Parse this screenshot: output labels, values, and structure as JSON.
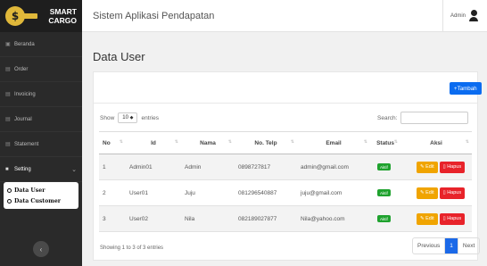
{
  "brand": {
    "line1": "SMART",
    "line2": "CARGO",
    "logo_glyph": "$"
  },
  "topbar": {
    "title": "Sistem Aplikasi Pendapatan",
    "user": "Admin"
  },
  "sidebar": {
    "items": [
      {
        "label": "Beranda",
        "icon": "home-icon"
      },
      {
        "label": "Order",
        "icon": "order-icon"
      },
      {
        "label": "Invoicing",
        "icon": "invoice-icon"
      },
      {
        "label": "Journal",
        "icon": "journal-icon"
      },
      {
        "label": "Statement",
        "icon": "statement-icon"
      },
      {
        "label": "Setting",
        "icon": "folder-icon"
      }
    ],
    "submenu": [
      "Data User",
      "Data Customer"
    ],
    "chevron": "⌄",
    "collapse_glyph": "‹"
  },
  "main": {
    "title": "Data User",
    "add_button": "+Tambah"
  },
  "controls": {
    "show": "Show",
    "entries_value": "10",
    "entries": "entries",
    "search_label": "Search:"
  },
  "table": {
    "headers": [
      "No",
      "Id",
      "Nama",
      "No. Telp",
      "Email",
      "Status",
      "Aksi"
    ],
    "rows": [
      {
        "no": "1",
        "id": "Admin01",
        "nama": "Admin",
        "telp": "0898727817",
        "email": "admin@gmail.com",
        "status": "Aktif"
      },
      {
        "no": "2",
        "id": "User01",
        "nama": "Juju",
        "telp": "081296540887",
        "email": "juju@gmail.com",
        "status": "Aktif"
      },
      {
        "no": "3",
        "id": "User02",
        "nama": "Nila",
        "telp": "082189027877",
        "email": "Nila@yahoo.com",
        "status": "Aktif"
      }
    ],
    "edit_label": "Edit",
    "delete_label": "Hapus"
  },
  "footer": {
    "info": "Showing 1 to 3 of 3 entries",
    "prev": "Previous",
    "page": "1",
    "next": "Next"
  },
  "colors": {
    "primary": "#0b6cf0",
    "edit": "#f0a400",
    "delete": "#e8232a",
    "active": "#1fa22e",
    "sidebar": "#2a2a2a"
  }
}
